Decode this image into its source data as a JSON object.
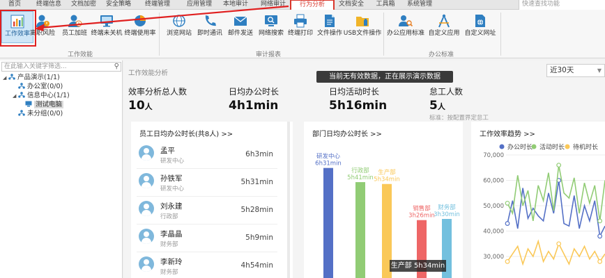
{
  "tabs": [
    "首页",
    "终端信息",
    "文档加密",
    "安全策略",
    "终端管理",
    "应用管理",
    "本地审计",
    "网络审计",
    "行为分析",
    "文档安全",
    "工具箱",
    "系统管理"
  ],
  "active_tab": "行为分析",
  "search_placeholder": "快速查找功能",
  "ribbon": {
    "buttons": [
      {
        "label": "工作效率",
        "icon": "bar-chart-icon"
      },
      {
        "label": "离职风险",
        "icon": "user-risk-icon"
      },
      {
        "label": "员工加班",
        "icon": "user-clock-icon"
      },
      {
        "label": "终端未关机",
        "icon": "monitor-icon"
      },
      {
        "label": "终端使用率",
        "icon": "pie-chart-icon"
      },
      {
        "label": "浏览网站",
        "icon": "globe-icon"
      },
      {
        "label": "即时通讯",
        "icon": "phone-icon"
      },
      {
        "label": "邮件发送",
        "icon": "mail-icon"
      },
      {
        "label": "网络搜索",
        "icon": "search-globe-icon"
      },
      {
        "label": "终端打印",
        "icon": "printer-icon"
      },
      {
        "label": "文件操作",
        "icon": "document-icon"
      },
      {
        "label": "USB文件操作",
        "icon": "usb-folder-icon"
      },
      {
        "label": "办公应用标准",
        "icon": "person-search-icon"
      },
      {
        "label": "自定义应用",
        "icon": "compass-icon"
      },
      {
        "label": "自定义网址",
        "icon": "web-document-icon"
      }
    ],
    "groups": [
      "工作效能",
      "审计报表",
      "办公标准"
    ]
  },
  "tree": {
    "search_placeholder": "在此输入关键字筛选...",
    "nodes": [
      "产品演示(1/1)",
      "办公室(0/0)",
      "信息中心(1/1)",
      "测试电脑",
      "未分组(0/0)"
    ]
  },
  "main": {
    "title": "工作效能分析",
    "notice": "当前无有效数据，正在展示演示数据",
    "range": "近30天",
    "kpis": [
      {
        "label": "效率分析总人数",
        "value": "10",
        "unit": "人"
      },
      {
        "label": "日均办公时长",
        "value": "4h1min"
      },
      {
        "label": "日均活动时长",
        "value": "5h16min"
      },
      {
        "label": "怠工人数",
        "value": "5",
        "unit": "人",
        "note": "标准：按配置界定怠工"
      }
    ],
    "employees_title": "员工日均办公时长(共8人) >>",
    "employees": [
      {
        "name": "孟平",
        "dept": "研发中心",
        "time": "6h3min"
      },
      {
        "name": "孙铁军",
        "dept": "研发中心",
        "time": "5h31min"
      },
      {
        "name": "刘永建",
        "dept": "行政部",
        "time": "5h28min"
      },
      {
        "name": "李晶晶",
        "dept": "财务部",
        "time": "5h9min"
      },
      {
        "name": "李新玲",
        "dept": "财务部",
        "time": "4h54min"
      }
    ],
    "dept_title": "部门日均办公时长 >>",
    "trend_title": "工作效率趋势 >>",
    "tooltip": "生产部 5h34min"
  },
  "colors": {
    "blue": "#5470c6",
    "green": "#91cc75",
    "yellow": "#fac858",
    "red": "#ee6666",
    "teal": "#73c0de",
    "accent_red": "#e02020"
  },
  "chart_data": [
    {
      "type": "bar",
      "categories": [
        "研发中心",
        "行政部",
        "生产部",
        "销售部",
        "财务部"
      ],
      "series": [
        {
          "name": "",
          "values": [
            6.52,
            5.68,
            5.57,
            3.43,
            3.5
          ]
        }
      ],
      "value_labels": [
        "6h31min",
        "5h41min",
        "5h34min",
        "3h26min",
        "3h30min"
      ],
      "title": "部门日均办公时长 >>"
    },
    {
      "type": "line",
      "title": "工作效率趋势 >>",
      "ylim": [
        30000,
        70000
      ],
      "yticks": [
        "70,000",
        "60,000",
        "50,000",
        "40,000",
        "30,000"
      ],
      "series": [
        {
          "name": "办公时长",
          "values": [
            43000,
            52000,
            41000,
            57000,
            45000,
            49000,
            46000,
            44000,
            55000,
            47000,
            60000,
            43000,
            42000,
            54000,
            41000,
            50000,
            44000,
            52000,
            38000,
            42000
          ]
        },
        {
          "name": "活动时长",
          "values": [
            51000,
            47000,
            62000,
            50000,
            56000,
            44000,
            58000,
            52000,
            63000,
            48000,
            66000,
            55000,
            53000,
            61000,
            47000,
            59000,
            51000,
            58000,
            44000,
            60000
          ]
        },
        {
          "name": "待机时长",
          "values": [
            28000,
            31000,
            34000,
            27000,
            33000,
            30000,
            36000,
            28000,
            32000,
            29000,
            35000,
            31000,
            27000,
            33000,
            30000,
            34000,
            29000,
            32000,
            28000,
            31000
          ]
        }
      ]
    }
  ]
}
